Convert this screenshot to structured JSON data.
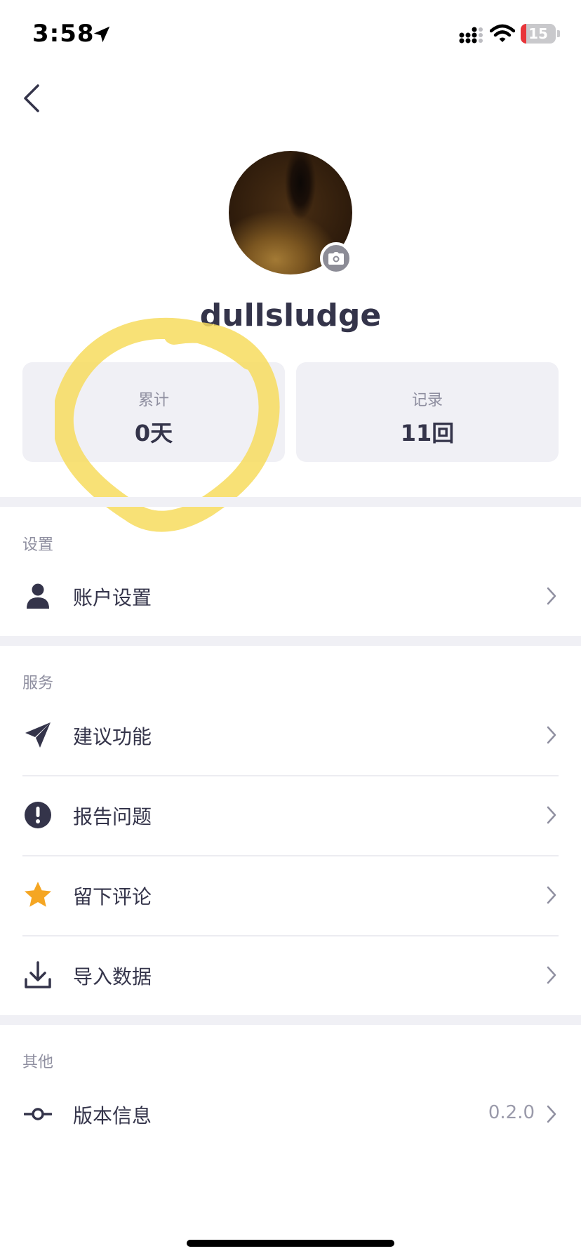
{
  "status_bar": {
    "time": "3:58",
    "battery_level": "15",
    "battery_fraction": 0.15,
    "battery_color": "#e8353a"
  },
  "profile": {
    "username": "dullsludge"
  },
  "stats": [
    {
      "label": "累计",
      "value": "0天"
    },
    {
      "label": "记录",
      "value": "11回"
    }
  ],
  "sections": {
    "settings": {
      "title": "设置",
      "items": [
        {
          "label": "账户设置",
          "icon": "person-icon"
        }
      ]
    },
    "services": {
      "title": "服务",
      "items": [
        {
          "label": "建议功能",
          "icon": "paper-plane-icon"
        },
        {
          "label": "报告问题",
          "icon": "exclamation-circle-icon"
        },
        {
          "label": "留下评论",
          "icon": "star-icon"
        },
        {
          "label": "导入数据",
          "icon": "download-icon"
        }
      ]
    },
    "other": {
      "title": "其他",
      "items": [
        {
          "label": "版本信息",
          "icon": "commit-icon",
          "value": "0.2.0"
        }
      ]
    }
  },
  "colors": {
    "text_primary": "#34344a",
    "text_secondary": "#8f8fa0",
    "card_background": "#f0f0f5",
    "star": "#f5a623",
    "highlight": "#f7dc5e"
  }
}
